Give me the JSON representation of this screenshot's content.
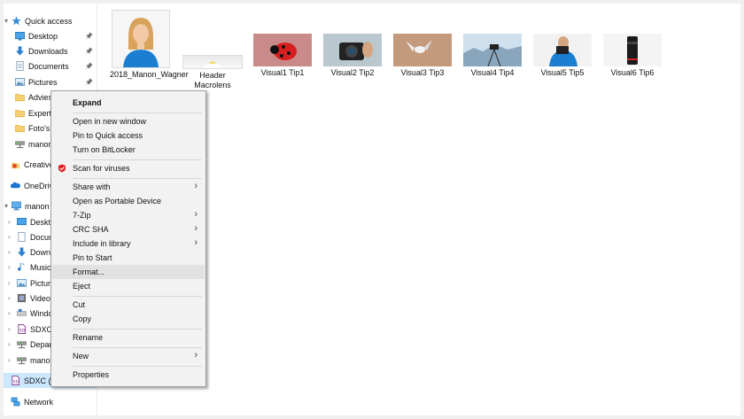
{
  "nav": {
    "quick_access": "Quick access",
    "items": [
      {
        "label": "Desktop",
        "pinned": true
      },
      {
        "label": "Downloads",
        "pinned": true
      },
      {
        "label": "Documents",
        "pinned": true
      },
      {
        "label": "Pictures",
        "pinned": true
      },
      {
        "label": "Advies"
      },
      {
        "label": "Expert"
      },
      {
        "label": "Foto's"
      },
      {
        "label": "manon"
      }
    ],
    "creative": "Creative",
    "onedrive": "OneDrive",
    "thispc": "manon",
    "pc_items": [
      "Deskto",
      "Docum",
      "Down",
      "Music",
      "Pictur",
      "Videos",
      "Windo",
      "SDXC",
      "Depar",
      "manon"
    ],
    "sdxc_selected": "SDXC (D",
    "network": "Network",
    "pin_glyph": "📌"
  },
  "files": [
    {
      "label": "2018_Manon_Wagner"
    },
    {
      "label": "Header Macrolens"
    },
    {
      "label": "Visual1 Tip1"
    },
    {
      "label": "Visual2 Tip2"
    },
    {
      "label": "Visual3 Tip3"
    },
    {
      "label": "Visual4 Tip4"
    },
    {
      "label": "Visual5 Tip5"
    },
    {
      "label": "Visual6 Tip6"
    }
  ],
  "menu": {
    "expand": "Expand",
    "open_new_window": "Open in new window",
    "pin_quick": "Pin to Quick access",
    "bitlocker": "Turn on BitLocker",
    "scan": "Scan for viruses",
    "share": "Share with",
    "portable": "Open as Portable Device",
    "zip": "7-Zip",
    "crc": "CRC SHA",
    "library": "Include in library",
    "pin_start": "Pin to Start",
    "format": "Format...",
    "eject": "Eject",
    "cut": "Cut",
    "copy": "Copy",
    "rename": "Rename",
    "new": "New",
    "properties": "Properties",
    "arrow": "›"
  }
}
